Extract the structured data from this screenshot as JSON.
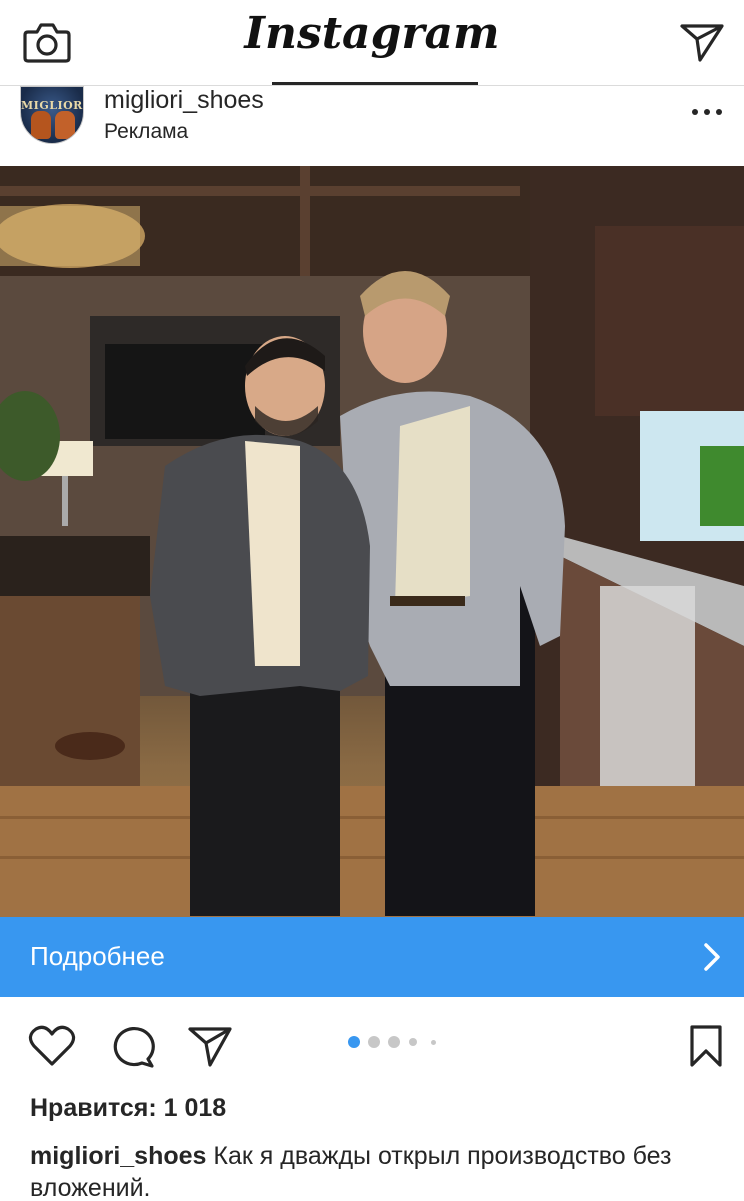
{
  "app": {
    "logo_text": "Instagram"
  },
  "post": {
    "username": "migliori_shoes",
    "sponsored_label": "Реклама",
    "avatar_brand": "MIGLIORI",
    "cta_label": "Подробнее",
    "likes_text": "Нравится: 1 018",
    "caption_user": "migliori_shoes",
    "caption_text": "Как я дважды открыл производство без вложений.",
    "carousel": {
      "total": 5,
      "current": 1
    }
  },
  "colors": {
    "cta": "#3897f0",
    "dot_active": "#3897f0",
    "dot_inactive": "#c7c7c7",
    "text": "#262626"
  },
  "icons": [
    "camera-icon",
    "direct-send-icon",
    "more-options-icon",
    "chevron-right-icon",
    "heart-icon",
    "comment-icon",
    "share-icon",
    "bookmark-icon"
  ]
}
